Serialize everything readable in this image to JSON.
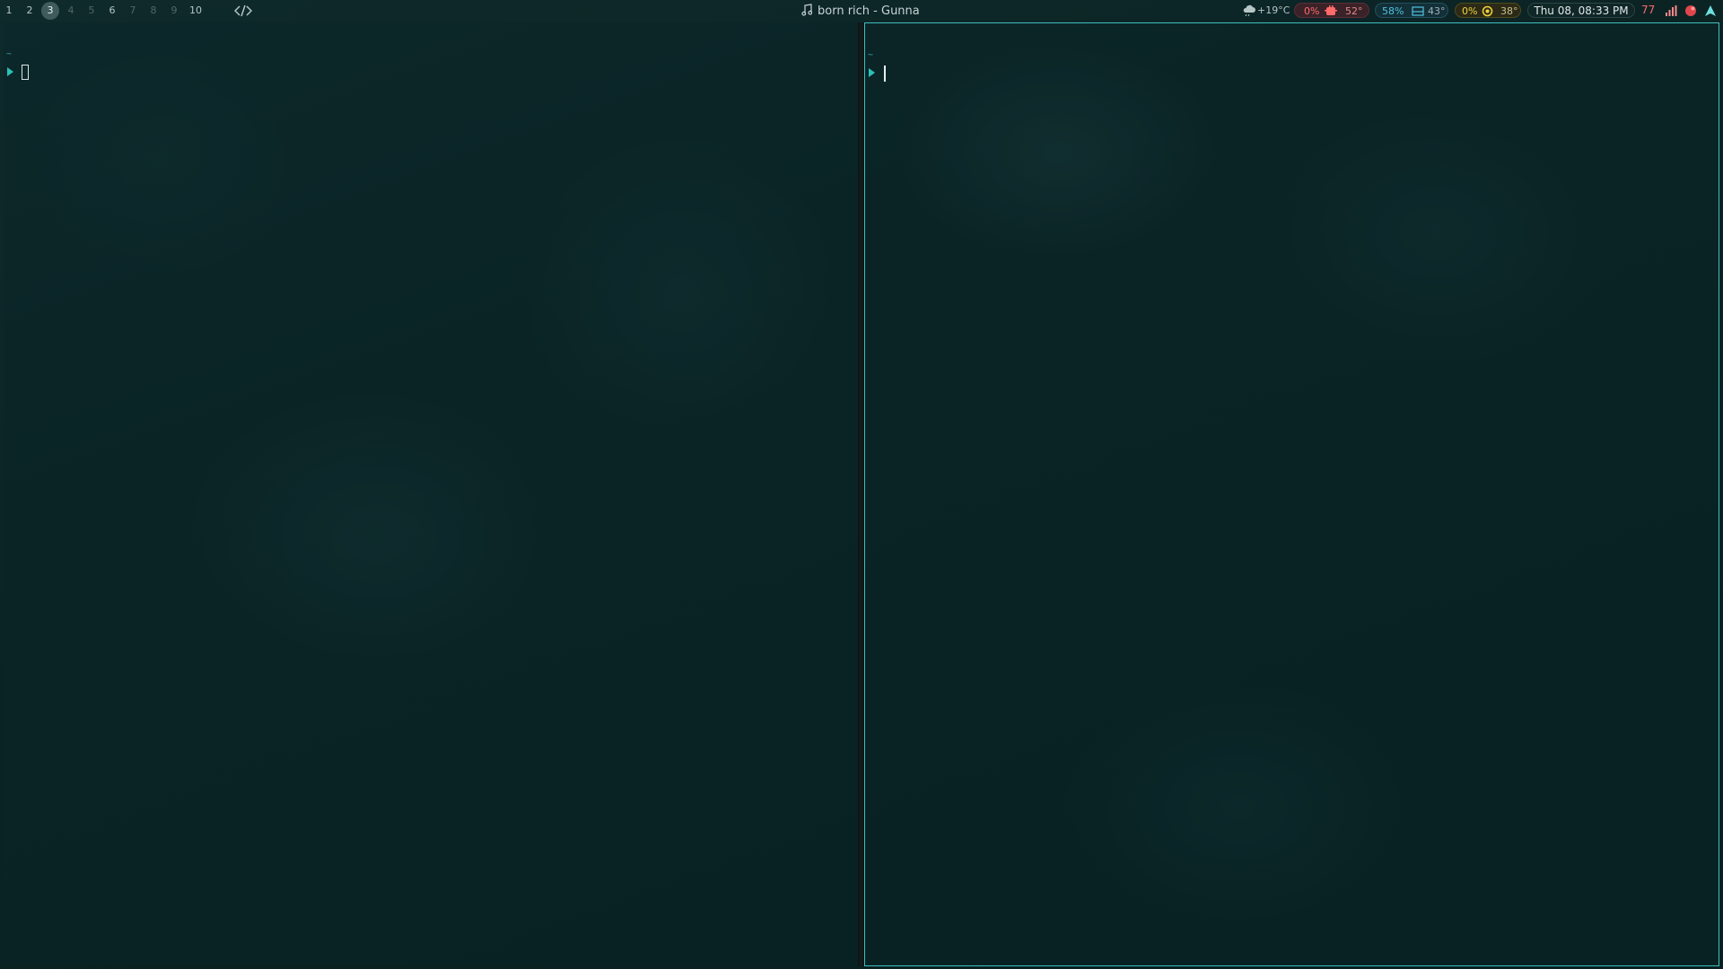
{
  "workspaces": [
    {
      "label": "1",
      "state": "normal"
    },
    {
      "label": "2",
      "state": "normal"
    },
    {
      "label": "3",
      "state": "active"
    },
    {
      "label": "4",
      "state": "dim"
    },
    {
      "label": "5",
      "state": "dim"
    },
    {
      "label": "6",
      "state": "normal"
    },
    {
      "label": "7",
      "state": "dim"
    },
    {
      "label": "8",
      "state": "dim"
    },
    {
      "label": "9",
      "state": "dim"
    },
    {
      "label": "10",
      "state": "normal"
    }
  ],
  "window_title": "born rich - Gunna",
  "status": {
    "weather": "+19°C",
    "cpu_usage": "0%",
    "cpu_temp": "52°",
    "ram_usage": "58%",
    "ram_temp": "43°",
    "gpu_usage": "0%",
    "gpu_temp": "38°",
    "datetime": "Thu 08, 08:33 PM",
    "updates": "77"
  },
  "terminals": {
    "left": {
      "cwd": "~"
    },
    "right": {
      "cwd": "~"
    }
  },
  "colors": {
    "accent": "#3fbfbf",
    "prompt": "#29c2b8",
    "cpu": "#ff6b6b",
    "ram": "#4fc3e0",
    "gpu": "#f2d43a"
  }
}
